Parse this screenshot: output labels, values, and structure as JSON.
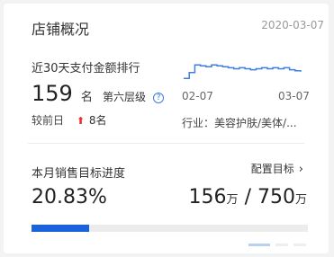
{
  "header": {
    "title": "店铺概况",
    "date": "2020-03-07"
  },
  "ranking": {
    "title": "近30天支付金额排行",
    "value": "159",
    "unit": "名",
    "level": "第六层级",
    "compare_label": "较前日",
    "compare_value": "8名",
    "compare_direction": "up"
  },
  "trend": {
    "start_date": "02-07",
    "end_date": "03-07",
    "industry": "行业：美容护肤/美体/...",
    "line_color": "#3f7fdf",
    "points": [
      8,
      14,
      22,
      21,
      20,
      22,
      21,
      20,
      19,
      18,
      19,
      18,
      17,
      18,
      19,
      18,
      19,
      18,
      19,
      17,
      16,
      15
    ]
  },
  "target": {
    "title": "本月销售目标进度",
    "link_label": "配置目标",
    "percent_text": "20.83%",
    "progress": 0.2083,
    "current": "156",
    "current_unit": "万",
    "separator": "/",
    "goal": "750",
    "goal_unit": "万",
    "accent": "#1a63dc"
  },
  "pager": {
    "count": 3,
    "active": 1
  }
}
